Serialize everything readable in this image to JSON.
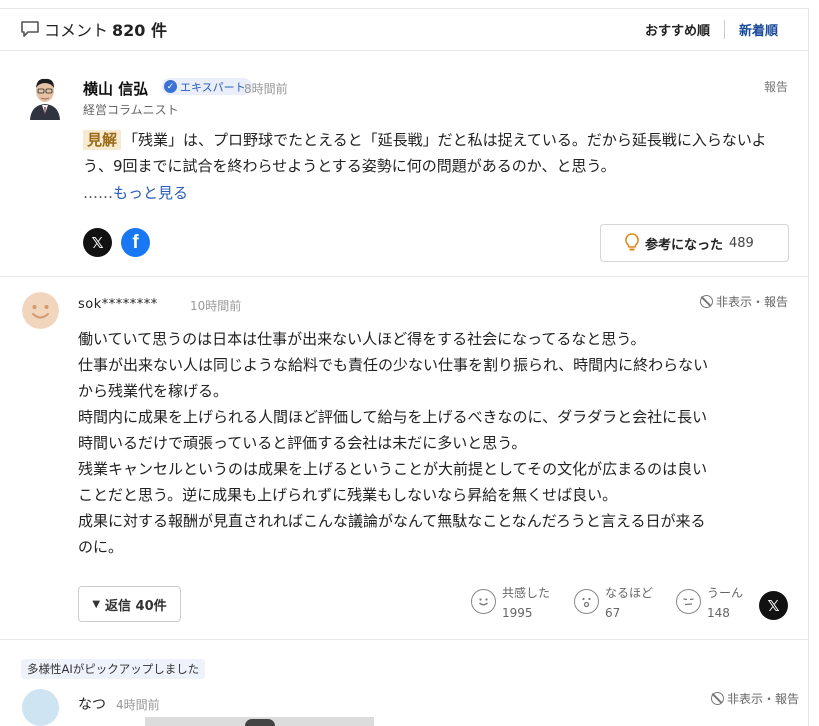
{
  "header": {
    "title_label": "コメント",
    "count": "820 件",
    "sort_recommended": "おすすめ順",
    "sort_newest": "新着順"
  },
  "expert_comment": {
    "name": "横山 信弘",
    "badge": "エキスパート",
    "time": "8時間前",
    "role": "経営コラムニスト",
    "report": "報告",
    "tag": "見解",
    "text": "「残業」は、プロ野球でたとえると「延長戦」だと私は捉えている。だから延長戦に入らないよう、9回までに試合を終わらせようとする姿勢に何の問題があるのか、と思う。",
    "more_prefix": "……",
    "more_link": "もっと見る",
    "helpful_label": "参考になった",
    "helpful_count": "489"
  },
  "user_comment": {
    "name": "sok********",
    "time": "10時間前",
    "hide_report": "非表示・報告",
    "lines": [
      "働いていて思うのは日本は仕事が出来ない人ほど得をする社会になってるなと思う。",
      "仕事が出来ない人は同じような給料でも責任の少ない仕事を割り振られ、時間内に終わらない",
      "から残業代を稼げる。",
      "時間内に成果を上げられる人間ほど評価して給与を上げるべきなのに、ダラダラと会社に長い",
      "時間いるだけで頑張っていると評価する会社は未だに多いと思う。",
      "残業キャンセルというのは成果を上げるということが大前提としてその文化が広まるのは良い",
      "ことだと思う。逆に成果も上げられずに残業もしないなら昇給を無くせば良い。",
      "成果に対する報酬が見直されればこんな議論がなんて無駄なことなんだろうと言える日が来る",
      "のに。"
    ],
    "reply_label": "返信 40件",
    "reactions": [
      {
        "label": "共感した",
        "count": "1995"
      },
      {
        "label": "なるほど",
        "count": "67"
      },
      {
        "label": "うーん",
        "count": "148"
      }
    ]
  },
  "ai_pick": {
    "tag": "多様性AIがピックアップしました",
    "name": "なつ",
    "time": "4時間前",
    "hide_report": "非表示・報告"
  },
  "colors": {
    "accent_blue": "#1a4b9c",
    "link_blue": "#2a5cb8",
    "kenkai_bg": "#f7ead0",
    "facebook": "#1877f2"
  }
}
